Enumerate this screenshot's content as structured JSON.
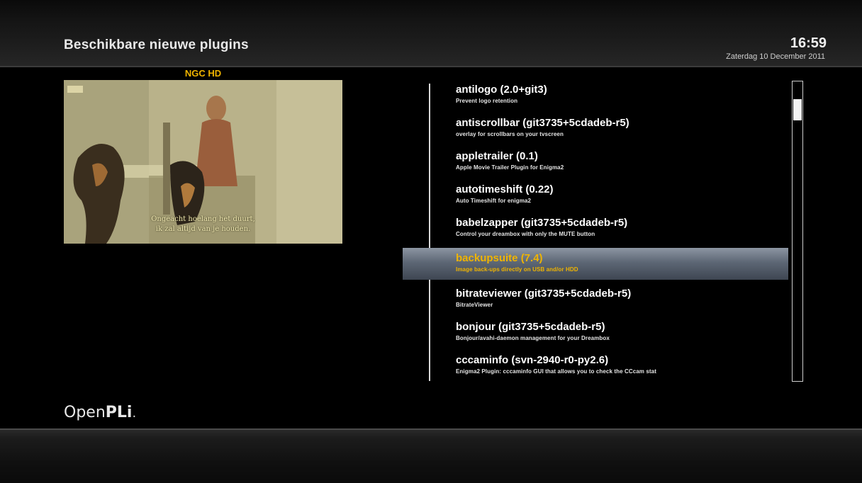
{
  "header": {
    "title": "Beschikbare nieuwe plugins",
    "time": "16:59",
    "date": "Zaterdag 10 December 2011"
  },
  "preview": {
    "channel": "NGC HD",
    "subtitles": [
      "Ongeacht hoelang het duurt,",
      "ik zal altijd van je houden."
    ]
  },
  "plugins": [
    {
      "name": "antilogo  (2.0+git3)",
      "description": "Prevent logo retention"
    },
    {
      "name": "antiscrollbar  (git3735+5cdadeb-r5)",
      "description": "overlay for scrollbars on your tvscreen"
    },
    {
      "name": "appletrailer  (0.1)",
      "description": "Apple Movie Trailer Plugin for Enigma2"
    },
    {
      "name": "autotimeshift  (0.22)",
      "description": "Auto Timeshift for enigma2"
    },
    {
      "name": "babelzapper  (git3735+5cdadeb-r5)",
      "description": "Control your dreambox with only the MUTE button"
    },
    {
      "name": "backupsuite  (7.4)",
      "description": "Image back-ups directly on USB and/or HDD",
      "selected": true
    },
    {
      "name": "bitrateviewer  (git3735+5cdadeb-r5)",
      "description": "BitrateViewer"
    },
    {
      "name": "bonjour  (git3735+5cdadeb-r5)",
      "description": "Bonjour/avahi-daemon management for your Dreambox"
    },
    {
      "name": "cccaminfo  (svn-2940-r0-py2.6)",
      "description": "Enigma2 Plugin: cccaminfo GUI that allows you to check the CCcam stat"
    }
  ],
  "branding": {
    "logo_open": "Open",
    "logo_pli": "PLi",
    "logo_dot": "."
  },
  "colors": {
    "accent": "#f0b400",
    "selection": "#5d6775",
    "background": "#000000"
  }
}
